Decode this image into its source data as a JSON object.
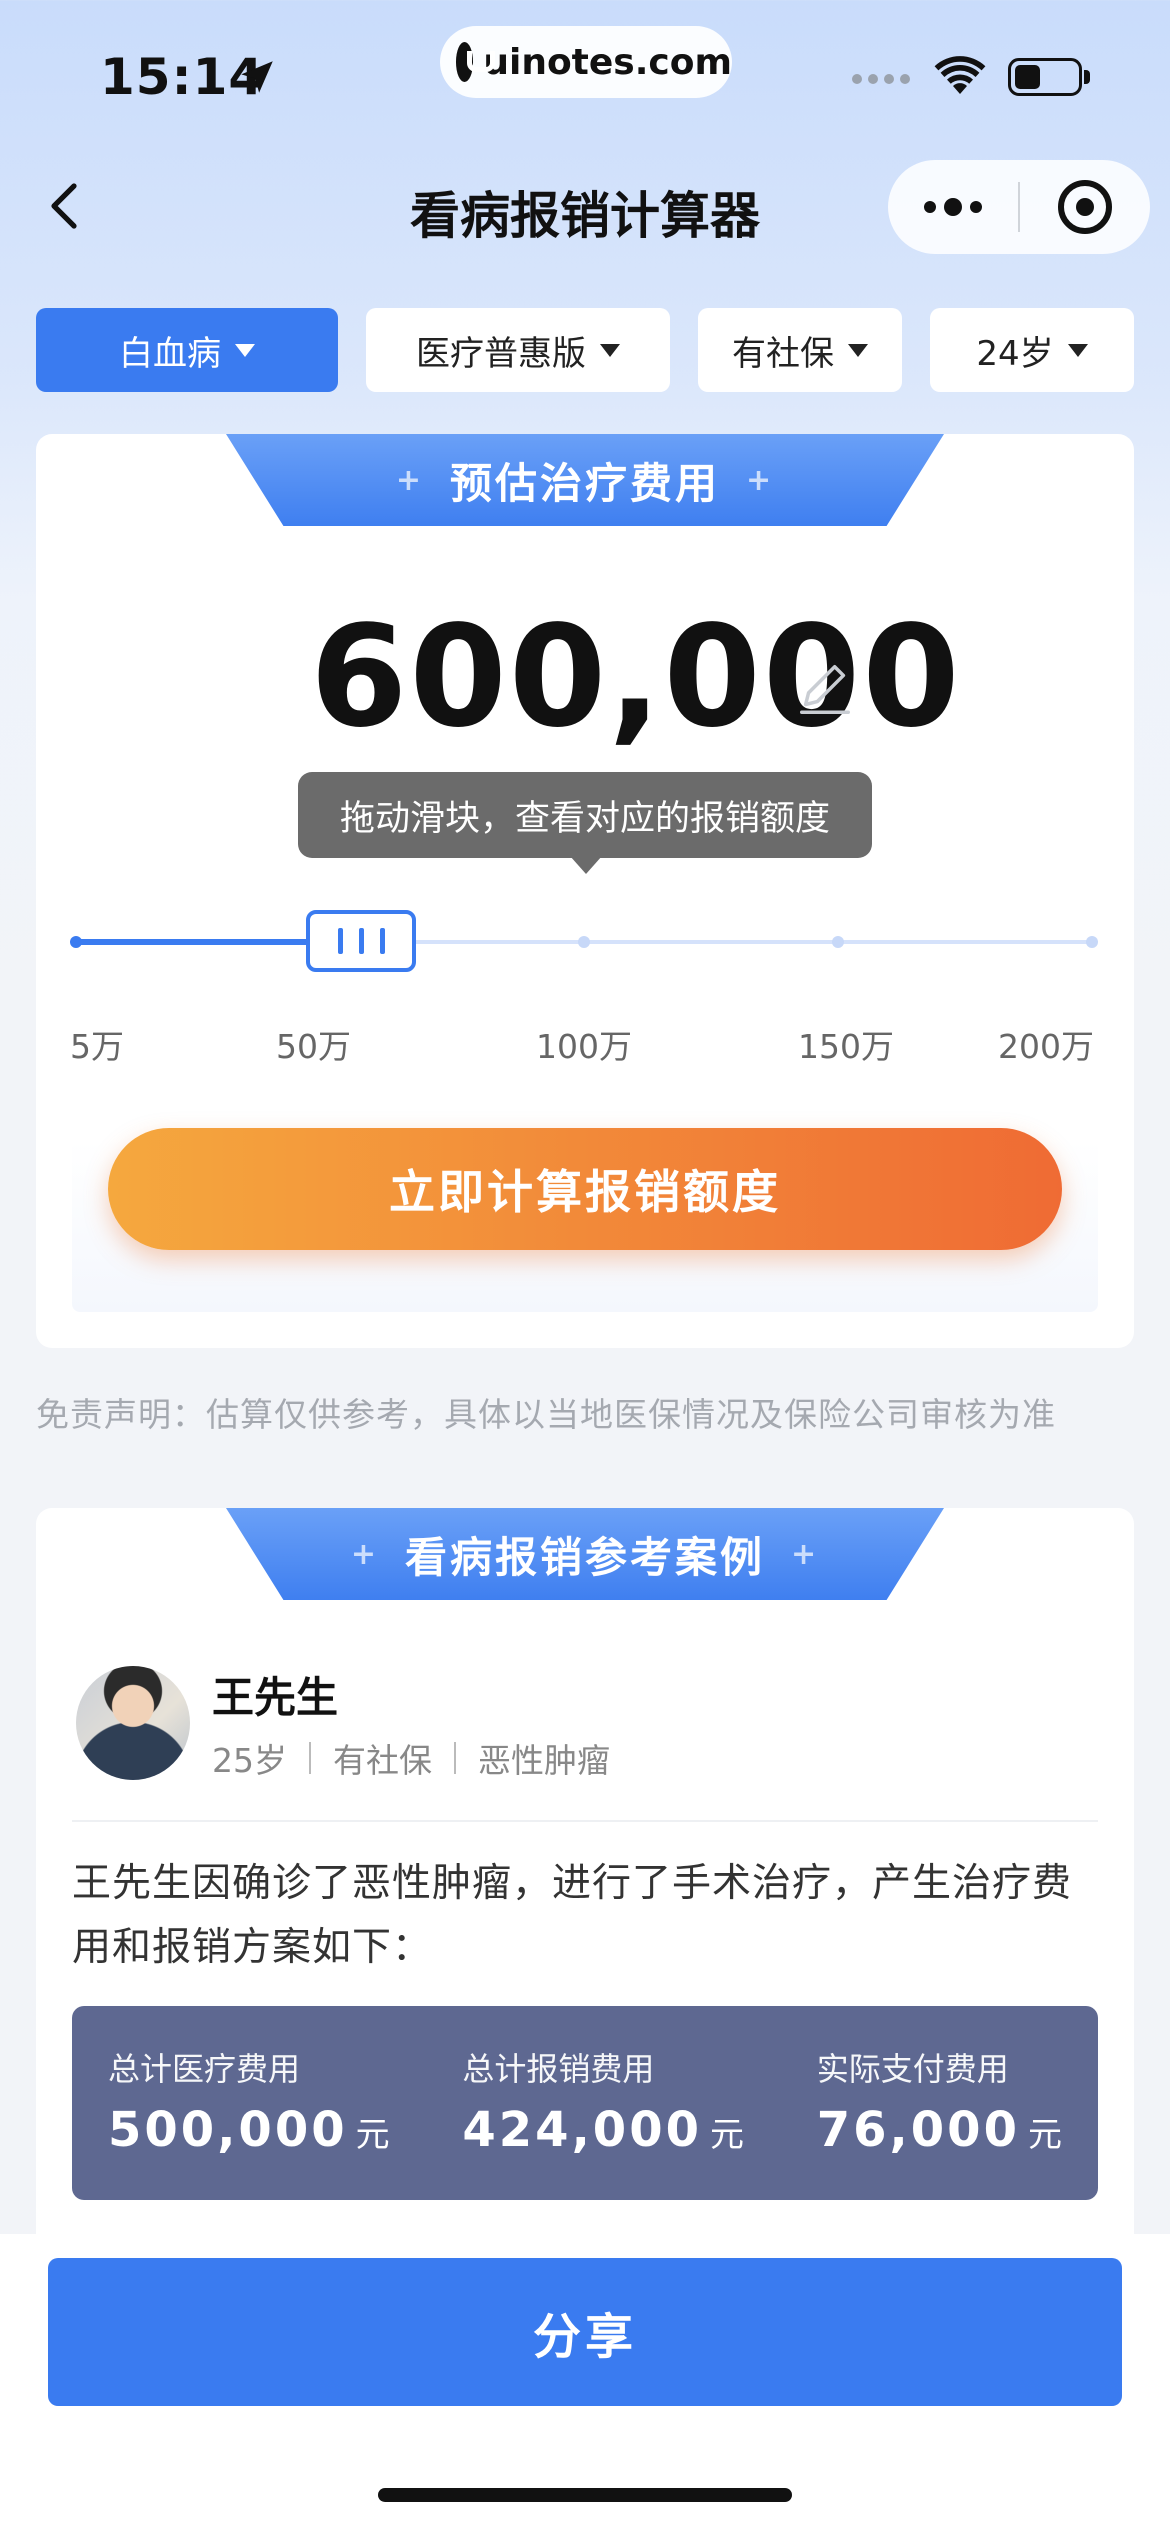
{
  "status_bar": {
    "time": "15:14",
    "url": "uinotes.com",
    "battery_level": 0.42
  },
  "header": {
    "title": "看病报销计算器"
  },
  "filters": [
    {
      "label": "白血病",
      "active": true
    },
    {
      "label": "医疗普惠版",
      "active": false
    },
    {
      "label": "有社保",
      "active": false
    },
    {
      "label": "24岁",
      "active": false
    }
  ],
  "estimate": {
    "section_title": "预估治疗费用",
    "amount": "600,000",
    "tooltip": "拖动滑块，查看对应的报销额度",
    "slider_value_wan": 60,
    "tick_labels": [
      "5万",
      "50万",
      "100万",
      "150万",
      "200万"
    ],
    "calc_button": "立即计算报销额度"
  },
  "disclaimer": "免责声明：估算仅供参考，具体以当地医保情况及保险公司审核为准",
  "case": {
    "section_title": "看病报销参考案例",
    "name": "王先生",
    "age": "25岁",
    "insurance": "有社保",
    "disease": "恶性肿瘤",
    "description": "王先生因确诊了恶性肿瘤，进行了手术治疗，产生治疗费用和报销方案如下：",
    "stats": [
      {
        "label": "总计医疗费用",
        "value": "500,000",
        "unit": "元"
      },
      {
        "label": "总计报销费用",
        "value": "424,000",
        "unit": "元"
      },
      {
        "label": "实际支付费用",
        "value": "76,000",
        "unit": "元"
      }
    ]
  },
  "footer": {
    "share_button": "分享"
  },
  "colors": {
    "primary": "#3a7bf0",
    "orange_start": "#f5a83e",
    "orange_end": "#ef6b34",
    "stats_bg": "#5e6891"
  }
}
